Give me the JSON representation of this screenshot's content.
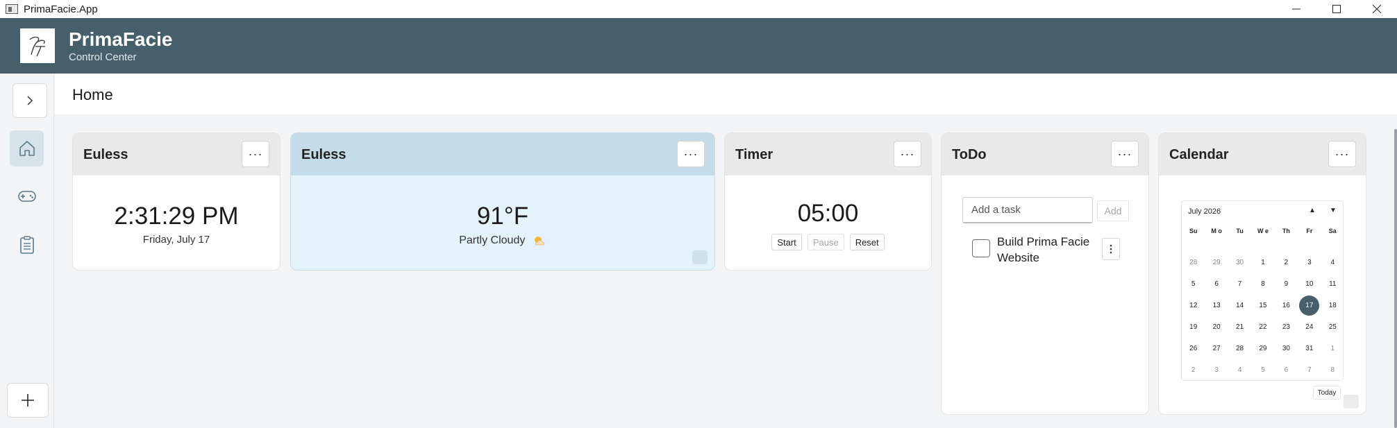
{
  "window": {
    "title": "PrimaFacie.App"
  },
  "header": {
    "app_name": "PrimaFacie",
    "subtitle": "Control Center"
  },
  "page": {
    "title": "Home"
  },
  "widgets": {
    "clock": {
      "title": "Euless",
      "time": "2:31:29 PM",
      "date": "Friday, July 17"
    },
    "weather": {
      "title": "Euless",
      "temperature": "91°F",
      "condition": "Partly Cloudy"
    },
    "timer": {
      "title": "Timer",
      "value": "05:00",
      "start": "Start",
      "pause": "Pause",
      "reset": "Reset"
    },
    "todo": {
      "title": "ToDo",
      "placeholder": "Add a task",
      "add_label": "Add",
      "items": [
        {
          "text": "Build Prima Facie Website",
          "done": false
        }
      ]
    },
    "calendar": {
      "title": "Calendar",
      "month_label": "July 2026",
      "weekdays": [
        "Su",
        "M o",
        "Tu",
        "W e",
        "Th",
        "Fr",
        "Sa"
      ],
      "weeks": [
        [
          "28",
          "29",
          "30",
          "1",
          "2",
          "3",
          "4"
        ],
        [
          "5",
          "6",
          "7",
          "8",
          "9",
          "10",
          "11"
        ],
        [
          "12",
          "13",
          "14",
          "15",
          "16",
          "17",
          "18"
        ],
        [
          "19",
          "20",
          "21",
          "22",
          "23",
          "24",
          "25"
        ],
        [
          "26",
          "27",
          "28",
          "29",
          "30",
          "31",
          "1"
        ],
        [
          "2",
          "3",
          "4",
          "5",
          "6",
          "7",
          "8"
        ]
      ],
      "selected_day": "17",
      "today_label": "Today"
    }
  },
  "more_label": "···",
  "colors": {
    "header": "#455f6b",
    "accent": "#455f6b",
    "weather_bg": "#e4f2fb",
    "weather_head": "#c4dbe8"
  }
}
